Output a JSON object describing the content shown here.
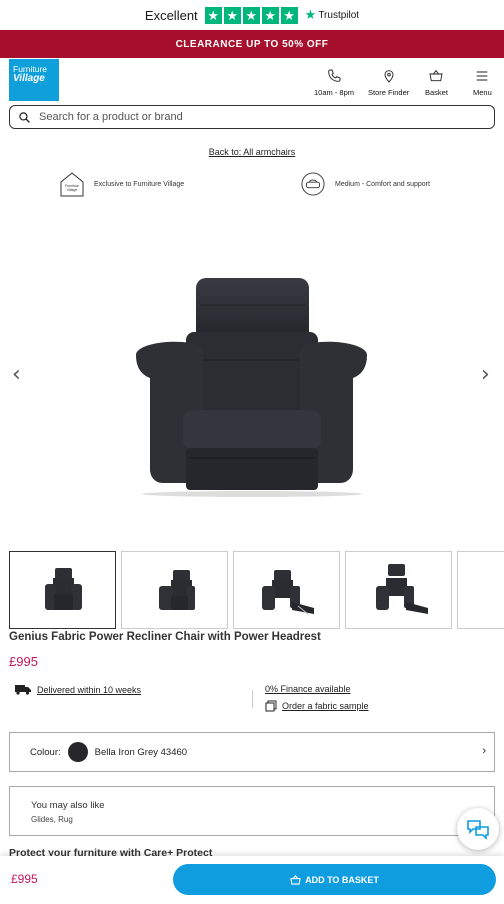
{
  "trustpilot": {
    "rating_text": "Excellent",
    "stars": "★",
    "brand": "Trustpilot"
  },
  "banner": {
    "text": "CLEARANCE UP TO 50% OFF"
  },
  "header": {
    "logo_line1": "Furniture",
    "logo_line2": "Village",
    "hours_label": "10am - 8pm",
    "store_finder_label": "Store Finder",
    "basket_label": "Basket",
    "menu_label": "Menu"
  },
  "search": {
    "placeholder": "Search for a product or brand"
  },
  "back_link": "Back to: All armchairs",
  "usps": {
    "exclusive": "Exclusive to Furniture Village",
    "exclusive_icon_line1": "Furniture",
    "exclusive_icon_line2": "Village",
    "comfort": "Medium - Comfort and support"
  },
  "gallery": {
    "prev_arrow": "‹",
    "next_arrow": "›"
  },
  "product": {
    "title": "Genius Fabric Power Recliner Chair with Power Headrest",
    "price": "£995"
  },
  "delivery": {
    "text": "Delivered within 10 weeks"
  },
  "finance": {
    "text": "0% Finance available"
  },
  "sample": {
    "text": "Order a fabric sample"
  },
  "colour": {
    "label": "Colour:",
    "value": "Bella Iron Grey 43460",
    "chevron": "›"
  },
  "also_like": {
    "title": "You may also like",
    "items": "Glides, Rug"
  },
  "protect": {
    "text": "Protect your furniture with Care+ Protect"
  },
  "sticky": {
    "price": "£995",
    "button_label": "ADD TO BASKET"
  },
  "colors": {
    "banner": "#a6102d",
    "accent_blue": "#0f9de0",
    "price": "#c2185b",
    "trustpilot_green": "#00b67a"
  }
}
